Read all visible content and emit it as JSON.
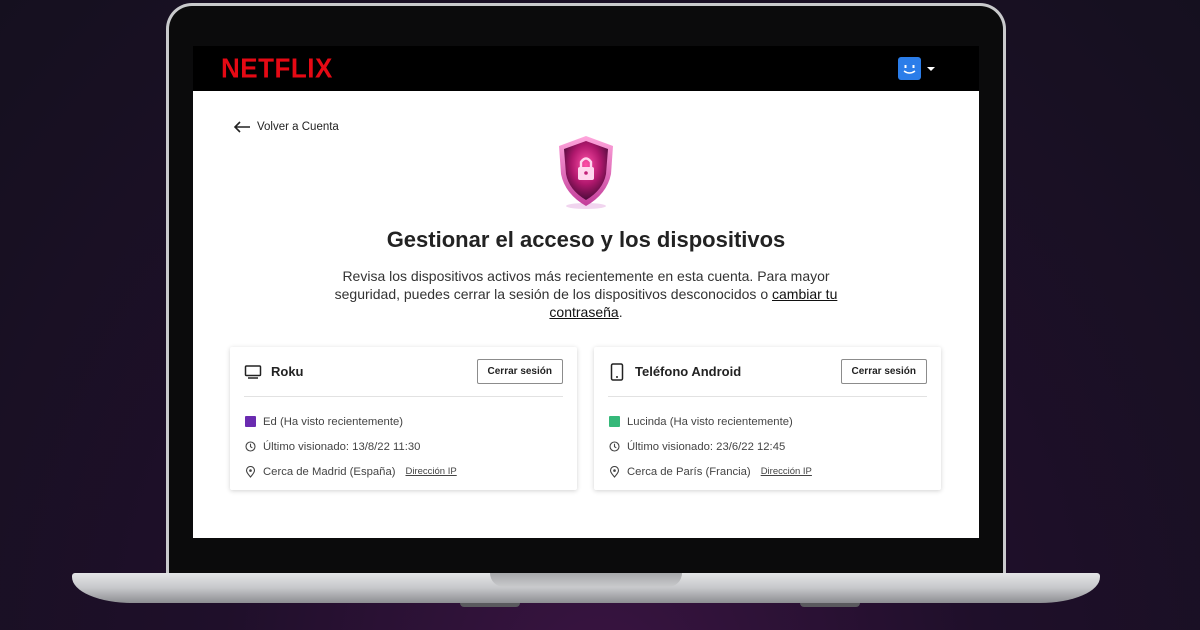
{
  "header": {
    "logo": "NETFLIX",
    "avatar_color": "#2b7de9",
    "accent": "#e50914"
  },
  "back_link": {
    "label": "Volver a Cuenta",
    "icon": "arrow-left-icon"
  },
  "hero": {
    "icon": "shield-lock-icon",
    "title": "Gestionar el acceso y los dispositivos",
    "description": "Revisa los dispositivos activos más recientemente en esta cuenta. Para mayor seguridad, puedes cerrar la sesión de los dispositivos desconocidos o ",
    "change_password_link": "cambiar tu contraseña",
    "description_end": "."
  },
  "devices": [
    {
      "icon": "tv-icon",
      "name": "Roku",
      "logout_label": "Cerrar sesión",
      "profile": "Ed (Ha visto recientemente)",
      "profile_color": "#6a2bb0",
      "last_viewed": "Último visionado: 13/8/22 11:30",
      "location": "Cerca de Madrid (España)",
      "ip_label": "Dirección IP"
    },
    {
      "icon": "phone-icon",
      "name": "Teléfono Android",
      "logout_label": "Cerrar sesión",
      "profile": "Lucinda (Ha visto recientemente)",
      "profile_color": "#35b879",
      "last_viewed": "Último visionado: 23/6/22 12:45",
      "location": "Cerca de París (Francia)",
      "ip_label": "Dirección IP"
    }
  ]
}
